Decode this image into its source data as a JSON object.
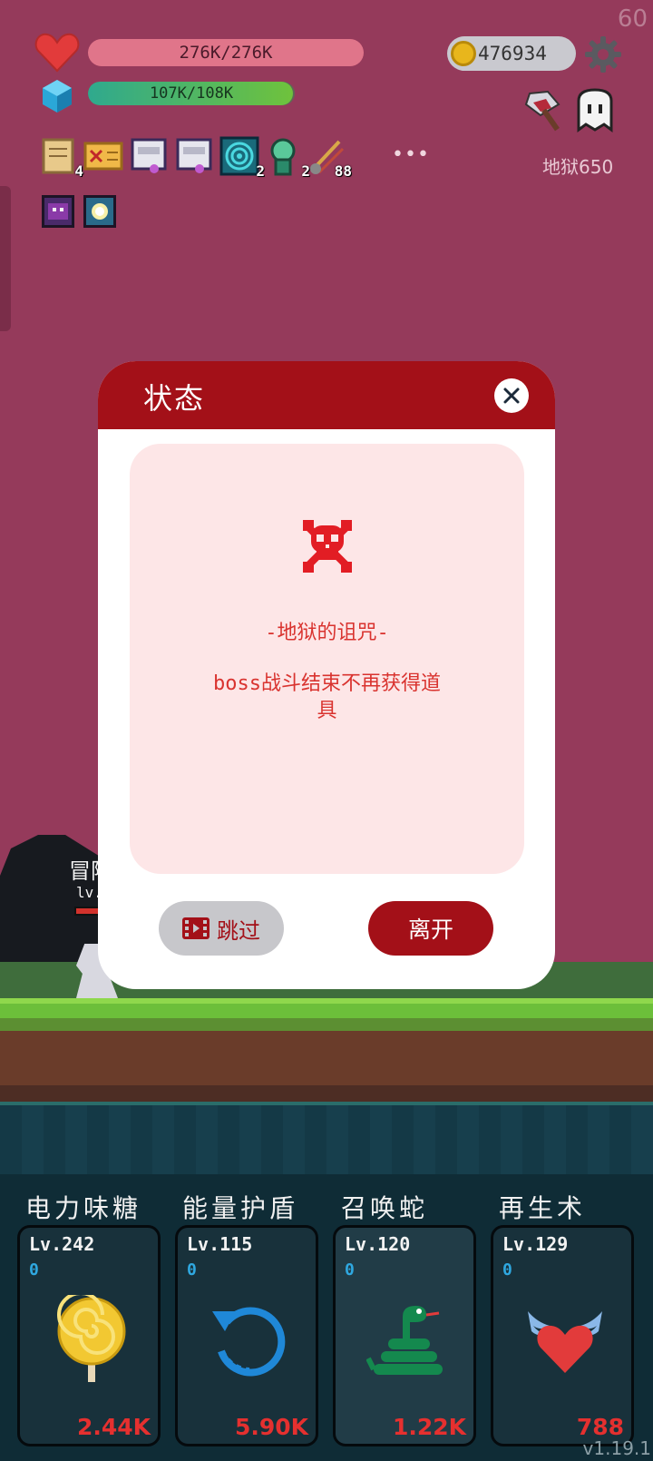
{
  "hud": {
    "hp_text": "276K/276K",
    "hp_fraction": 1.0,
    "energy_text": "107K/108K",
    "energy_fraction": 0.99,
    "coins": "476934",
    "fps": "60",
    "stage_label": "地狱650"
  },
  "buffs": [
    {
      "icon": "scroll-icon",
      "count": "4"
    },
    {
      "icon": "map-icon",
      "count": ""
    },
    {
      "icon": "flag-icon",
      "count": ""
    },
    {
      "icon": "flag-icon",
      "count": ""
    },
    {
      "icon": "spiral-icon",
      "count": "2"
    },
    {
      "icon": "spirit-icon",
      "count": "2"
    },
    {
      "icon": "meteor-icon",
      "count": "88"
    }
  ],
  "more_label": "•••",
  "hero": {
    "label": "冒险",
    "level": "lv."
  },
  "modal": {
    "title": "状态",
    "curse_title": "-地狱的诅咒-",
    "curse_desc": "boss战斗结束不再获得道具",
    "skip_label": "跳过",
    "leave_label": "离开"
  },
  "skills": [
    {
      "name": "电力味糖",
      "level": "Lv.242",
      "count": "0",
      "cost": "2.44K",
      "icon": "lollipop-icon"
    },
    {
      "name": "能量护盾",
      "level": "Lv.115",
      "count": "0",
      "cost": "5.90K",
      "icon": "rotate-icon"
    },
    {
      "name": "召唤蛇",
      "level": "Lv.120",
      "count": "0",
      "cost": "1.22K",
      "icon": "snake-icon"
    },
    {
      "name": "再生术",
      "level": "Lv.129",
      "count": "0",
      "cost": "788",
      "icon": "winged-heart-icon"
    }
  ],
  "version": "v1.19.1",
  "colors": {
    "modal_red": "#a31018",
    "sky": "#953a5b",
    "cost_red": "#e5302f"
  }
}
